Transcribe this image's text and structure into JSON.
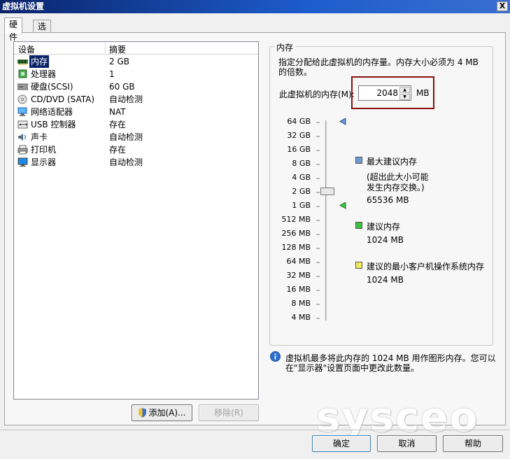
{
  "window": {
    "title": "虚拟机设置",
    "close": "X"
  },
  "tabs": [
    "硬件",
    "选项"
  ],
  "devices": {
    "header": {
      "device": "设备",
      "summary": "摘要"
    },
    "rows": [
      {
        "name": "内存",
        "summary": "2 GB",
        "icon": "memory-icon"
      },
      {
        "name": "处理器",
        "summary": "1",
        "icon": "processor-icon"
      },
      {
        "name": "硬盘(SCSI)",
        "summary": "60 GB",
        "icon": "harddisk-icon"
      },
      {
        "name": "CD/DVD (SATA)",
        "summary": "自动检测",
        "icon": "cd-dvd-icon"
      },
      {
        "name": "网络适配器",
        "summary": "NAT",
        "icon": "network-adapter-icon"
      },
      {
        "name": "USB 控制器",
        "summary": "存在",
        "icon": "usb-icon"
      },
      {
        "name": "声卡",
        "summary": "自动检测",
        "icon": "sound-card-icon"
      },
      {
        "name": "打印机",
        "summary": "存在",
        "icon": "printer-icon"
      },
      {
        "name": "显示器",
        "summary": "自动检测",
        "icon": "display-icon"
      }
    ],
    "selected_index": 0,
    "add_button": "添加(A)...",
    "remove_button": "移除(R)"
  },
  "memory": {
    "group_title": "内存",
    "description_line1": "指定分配给此虚拟机的内存量。内存大小必须为 4 MB",
    "description_line2": "的倍数。",
    "field_label": "此虚拟机的内存(M):",
    "value": "2048",
    "unit": "MB",
    "scale": [
      "64 GB",
      "32 GB",
      "16 GB",
      "8 GB",
      "4 GB",
      "2 GB",
      "1 GB",
      "512 MB",
      "256 MB",
      "128 MB",
      "64 MB",
      "32 MB",
      "16 MB",
      "8 MB",
      "4 MB"
    ],
    "legend": {
      "max": {
        "title": "最大建议内存",
        "note1": "(超出此大小可能",
        "note2": "发生内存交换。)",
        "value": "65536 MB",
        "color": "#6d9bd1"
      },
      "recommended": {
        "title": "建议内存",
        "value": "1024 MB",
        "color": "#3cc23c"
      },
      "min": {
        "title": "建议的最小客户机操作系统内存",
        "value": "1024 MB",
        "color": "#f2ec5a"
      }
    },
    "info_line1": "虚拟机最多将此内存的 1024 MB 用作图形内存。您可以",
    "info_line2": "在\"显示器\"设置页面中更改此数量。"
  },
  "buttons": {
    "ok": "确定",
    "cancel": "取消",
    "help": "帮助"
  },
  "watermark": "sysceo"
}
